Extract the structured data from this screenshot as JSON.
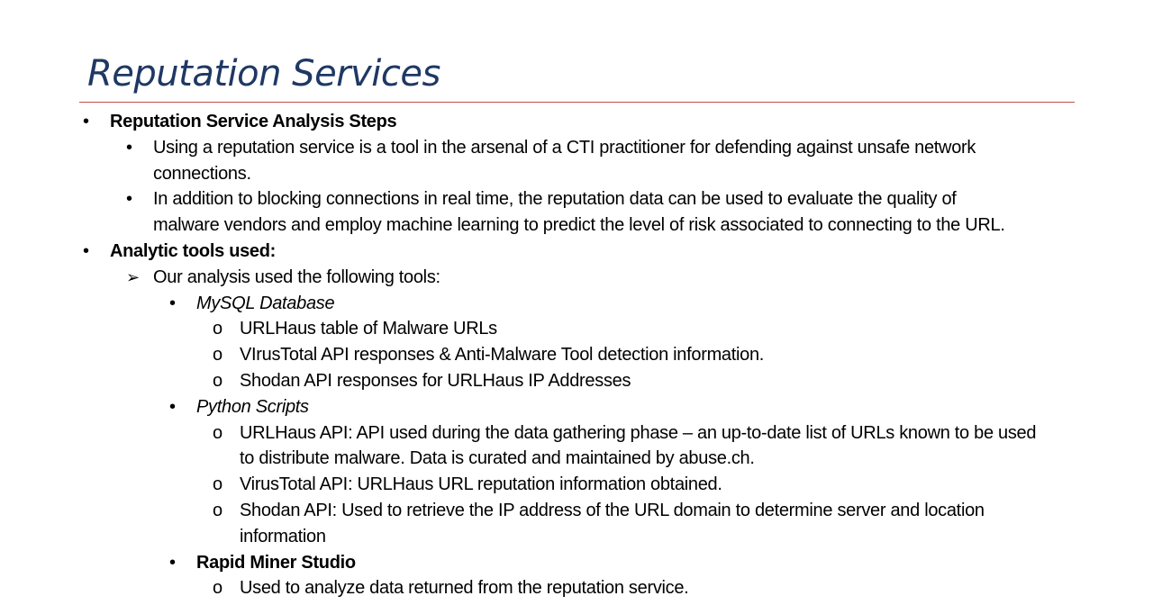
{
  "slide": {
    "title": "Reputation Services"
  },
  "sections": [
    {
      "heading": "Reputation Service Analysis Steps",
      "items": [
        {
          "line1": "Using a reputation service is a tool in the arsenal of a CTI practitioner for defending against unsafe network",
          "line2": "connections."
        },
        {
          "line1": "In addition to blocking connections in real time, the reputation data can be used to evaluate the quality of",
          "line2": "malware vendors and employ machine learning to  predict the level of risk associated to connecting to the URL."
        }
      ]
    },
    {
      "heading": "Analytic tools used:",
      "intro": "Our analysis used the following tools:",
      "tools": [
        {
          "name": "MySQL Database",
          "items": [
            "URLHaus table of Malware URLs",
            "VIrusTotal API responses & Anti-Malware Tool detection information.",
            "Shodan API responses for URLHaus IP Addresses"
          ]
        },
        {
          "name": "Python Scripts",
          "items": [
            {
              "line1": "URLHaus API:  API used during the data gathering phase – an up-to-date list of URLs known to be used",
              "line2": "to distribute malware. Data is curated and maintained by abuse.ch."
            },
            {
              "line1": "VirusTotal API:  URLHaus URL reputation information obtained."
            },
            {
              "line1": "Shodan API:  Used to retrieve the IP address of the URL domain to determine server and location",
              "line2": "information"
            }
          ]
        },
        {
          "name": "Rapid Miner Studio",
          "items": [
            "Used to analyze data returned from the reputation service."
          ]
        }
      ]
    }
  ],
  "icons": {
    "bullet": "•",
    "arrow": "➢",
    "circle": "o"
  },
  "colors": {
    "title": "#1f3864",
    "rule": "#c0504d"
  }
}
